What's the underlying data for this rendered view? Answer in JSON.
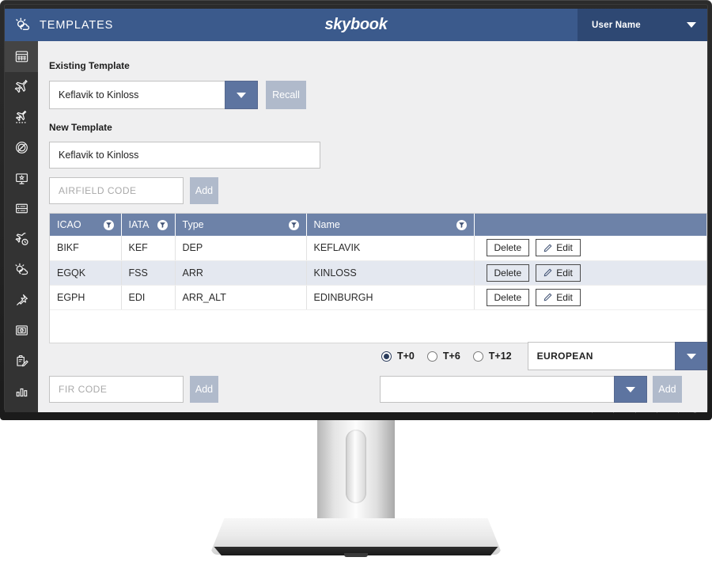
{
  "header": {
    "weather_icon": "sun-cloud-icon",
    "title": "TEMPLATES",
    "brand": "skybook",
    "user_name": "User Name",
    "user_caret_icon": "chevron-down-icon"
  },
  "sidebar": {
    "items": [
      {
        "icon": "grid-calendar-icon",
        "active": true
      },
      {
        "icon": "airplane-icon",
        "active": false
      },
      {
        "icon": "airplane-route-icon",
        "active": false
      },
      {
        "icon": "compass-no-entry-icon",
        "active": false
      },
      {
        "icon": "briefing-board-icon",
        "active": false
      },
      {
        "icon": "server-rack-icon",
        "active": false
      },
      {
        "icon": "airplane-clock-icon",
        "active": false
      },
      {
        "icon": "sun-cloud-icon",
        "active": false
      },
      {
        "icon": "pushpin-icon",
        "active": false
      },
      {
        "icon": "safe-box-icon",
        "active": false
      },
      {
        "icon": "clipboard-edit-icon",
        "active": false
      },
      {
        "icon": "bar-chart-icon",
        "active": false
      }
    ]
  },
  "existing_template": {
    "label": "Existing Template",
    "value": "Keflavik to Kinloss",
    "dropdown_icon": "caret-down-icon",
    "recall_label": "Recall"
  },
  "new_template": {
    "label": "New Template",
    "value": "Keflavik to Kinloss",
    "airfield_placeholder": "AIRFIELD CODE",
    "airfield_value": "",
    "add_label": "Add"
  },
  "table": {
    "columns": [
      {
        "label": "ICAO",
        "filter_icon": "filter-icon"
      },
      {
        "label": "IATA",
        "filter_icon": "filter-icon"
      },
      {
        "label": "Type",
        "filter_icon": "filter-icon"
      },
      {
        "label": "Name",
        "filter_icon": "filter-icon"
      },
      {
        "label": "",
        "filter_icon": ""
      }
    ],
    "rows": [
      {
        "icao": "BIKF",
        "iata": "KEF",
        "type": "DEP",
        "name": "KEFLAVIK",
        "delete_label": "Delete",
        "edit_label": "Edit"
      },
      {
        "icao": "EGQK",
        "iata": "FSS",
        "type": "ARR",
        "name": "KINLOSS",
        "delete_label": "Delete",
        "edit_label": "Edit"
      },
      {
        "icao": "EGPH",
        "iata": "EDI",
        "type": "ARR_ALT",
        "name": "EDINBURGH",
        "delete_label": "Delete",
        "edit_label": "Edit"
      }
    ]
  },
  "footer": {
    "fir_placeholder": "FIR CODE",
    "fir_value": "",
    "fir_add_label": "Add",
    "radios": [
      {
        "label": "T+0",
        "selected": true
      },
      {
        "label": "T+6",
        "selected": false
      },
      {
        "label": "T+12",
        "selected": false
      }
    ],
    "region_value": "EUROPEAN",
    "region_dropdown_icon": "caret-down-icon",
    "chart_value": "",
    "chart_dropdown_icon": "caret-down-icon",
    "chart_add_label": "Add"
  },
  "colors": {
    "header_blue": "#3b5a8c",
    "user_blue": "#2e4873",
    "table_header_blue": "#6d82a8",
    "dropdown_blue": "#5d74a0",
    "button_gray": "#b0bacb",
    "sidebar_dark": "#333333",
    "page_bg": "#efeff0",
    "row_alt": "#e4e8f0"
  }
}
